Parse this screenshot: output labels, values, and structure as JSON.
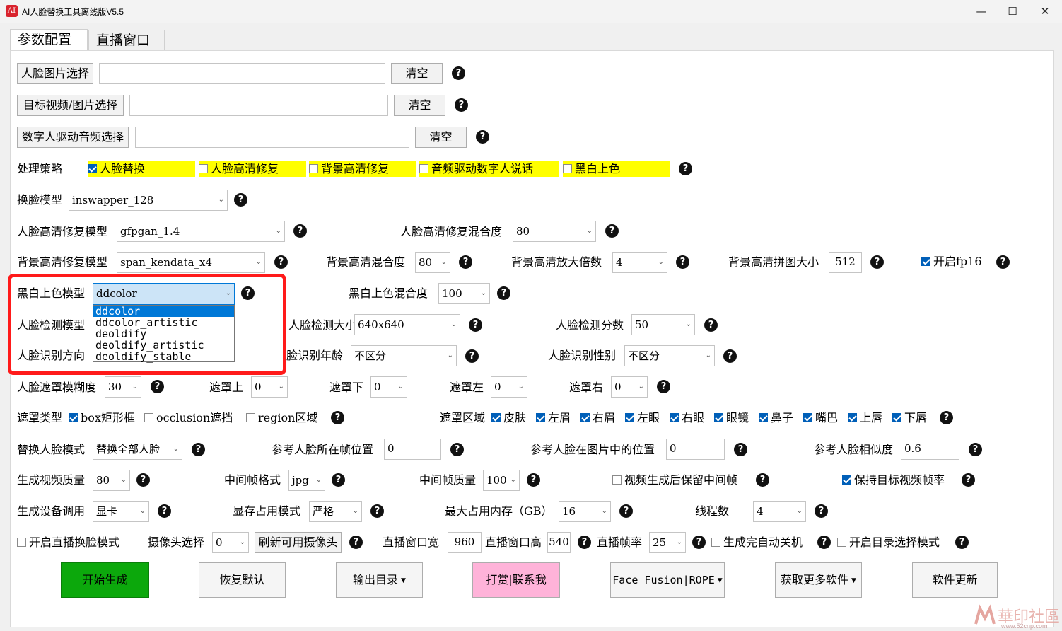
{
  "window": {
    "title": "AI人脸替换工具离线版V5.5",
    "icon_label": "AI"
  },
  "tabs": [
    {
      "label": "参数配置"
    },
    {
      "label": "直播窗口"
    }
  ],
  "files": {
    "face_btn": "人脸图片选择",
    "face_value": "",
    "face_clear": "清空",
    "target_btn": "目标视频/图片选择",
    "target_value": "",
    "target_clear": "清空",
    "audio_btn": "数字人驱动音频选择",
    "audio_value": "",
    "audio_clear": "清空"
  },
  "strategy": {
    "label": "处理策略",
    "options": [
      {
        "label": "人脸替换",
        "checked": true
      },
      {
        "label": "人脸高清修复",
        "checked": false
      },
      {
        "label": "背景高清修复",
        "checked": false
      },
      {
        "label": "音频驱动数字人说话",
        "checked": false
      },
      {
        "label": "黑白上色",
        "checked": false
      }
    ]
  },
  "swap": {
    "label": "换脸模型",
    "value": "inswapper_128"
  },
  "face_enhance": {
    "label": "人脸高清修复模型",
    "value": "gfpgan_1.4",
    "blend_label": "人脸高清修复混合度",
    "blend_value": "80"
  },
  "bg_enhance": {
    "label": "背景高清修复模型",
    "value": "span_kendata_x4",
    "blend_label": "背景高清混合度",
    "blend_value": "80",
    "scale_label": "背景高清放大倍数",
    "scale_value": "4",
    "tile_label": "背景高清拼图大小",
    "tile_value": "512",
    "fp16_label": "开启fp16",
    "fp16_checked": true
  },
  "colorize": {
    "label": "黑白上色模型",
    "value": "ddcolor",
    "blend_label": "黑白上色混合度",
    "blend_value": "100",
    "options": [
      "ddcolor",
      "ddcolor_artistic",
      "deoldify",
      "deoldify_artistic",
      "deoldify_stable"
    ]
  },
  "detect": {
    "label": "人脸检测模型",
    "size_label": "人脸检测大小",
    "size_value": "640x640",
    "score_label": "人脸检测分数",
    "score_value": "50"
  },
  "recognize": {
    "label": "人脸识别方向",
    "age_label": "脸识别年龄",
    "age_value": "不区分",
    "gender_label": "人脸识别性别",
    "gender_value": "不区分"
  },
  "mask": {
    "blur_label": "人脸遮罩模糊度",
    "blur_value": "30",
    "top_label": "遮罩上",
    "top_value": "0",
    "bottom_label": "遮罩下",
    "bottom_value": "0",
    "left_label": "遮罩左",
    "left_value": "0",
    "right_label": "遮罩右",
    "right_value": "0"
  },
  "mask_type": {
    "label": "遮罩类型",
    "types": [
      {
        "label": "box矩形框",
        "checked": true
      },
      {
        "label": "occlusion遮挡",
        "checked": false
      },
      {
        "label": "region区域",
        "checked": false
      }
    ],
    "region_label": "遮罩区域",
    "regions": [
      {
        "label": "皮肤",
        "checked": true
      },
      {
        "label": "左眉",
        "checked": true
      },
      {
        "label": "右眉",
        "checked": true
      },
      {
        "label": "左眼",
        "checked": true
      },
      {
        "label": "右眼",
        "checked": true
      },
      {
        "label": "眼镜",
        "checked": true
      },
      {
        "label": "鼻子",
        "checked": true
      },
      {
        "label": "嘴巴",
        "checked": true
      },
      {
        "label": "上唇",
        "checked": true
      },
      {
        "label": "下唇",
        "checked": true
      }
    ]
  },
  "replace": {
    "mode_label": "替换人脸模式",
    "mode_value": "替换全部人脸",
    "frame_label": "参考人脸所在帧位置",
    "frame_value": "0",
    "pos_label": "参考人脸在图片中的位置",
    "pos_value": "0",
    "sim_label": "参考人脸相似度",
    "sim_value": "0.6"
  },
  "output": {
    "quality_label": "生成视频质量",
    "quality_value": "80",
    "fmt_label": "中间帧格式",
    "fmt_value": "jpg",
    "fq_label": "中间帧质量",
    "fq_value": "100",
    "keep_label": "视频生成后保留中间帧",
    "keep_checked": false,
    "fps_label": "保持目标视频帧率",
    "fps_checked": true
  },
  "device": {
    "label": "生成设备调用",
    "value": "显卡",
    "mem_mode_label": "显存占用模式",
    "mem_mode_value": "严格",
    "mem_max_label": "最大占用内存（GB）",
    "mem_max_value": "16",
    "threads_label": "线程数",
    "threads_value": "4"
  },
  "live": {
    "enable_label": "开启直播换脸模式",
    "enable_checked": false,
    "cam_label": "摄像头选择",
    "cam_value": "0",
    "refresh_btn": "刷新可用摄像头",
    "width_label": "直播窗口宽",
    "width_value": "960",
    "height_label": "直播窗口高",
    "height_value": "540",
    "fps_label": "直播帧率",
    "fps_value": "25",
    "shutdown_label": "生成完自动关机",
    "shutdown_checked": false,
    "dirsel_label": "开启目录选择模式",
    "dirsel_checked": false
  },
  "actions": {
    "start": "开始生成",
    "reset": "恢复默认",
    "outdir": "输出目录",
    "donate": "打赏|联系我",
    "ff": "Face Fusion|ROPE",
    "more": "获取更多软件",
    "update": "软件更新"
  },
  "watermark": {
    "text": "華印社區",
    "url": "www.52cnp.com"
  },
  "colors": {
    "accent": "#0078d7",
    "yellow": "#ffff00",
    "start_green": "#0ca80c",
    "donate_pink": "#ffb3d9",
    "highlight_red": "#ff1a1a"
  },
  "icons": [
    "help-icon",
    "checkbox-icon",
    "chevron-down-icon",
    "minimize-icon",
    "maximize-icon",
    "close-icon"
  ]
}
